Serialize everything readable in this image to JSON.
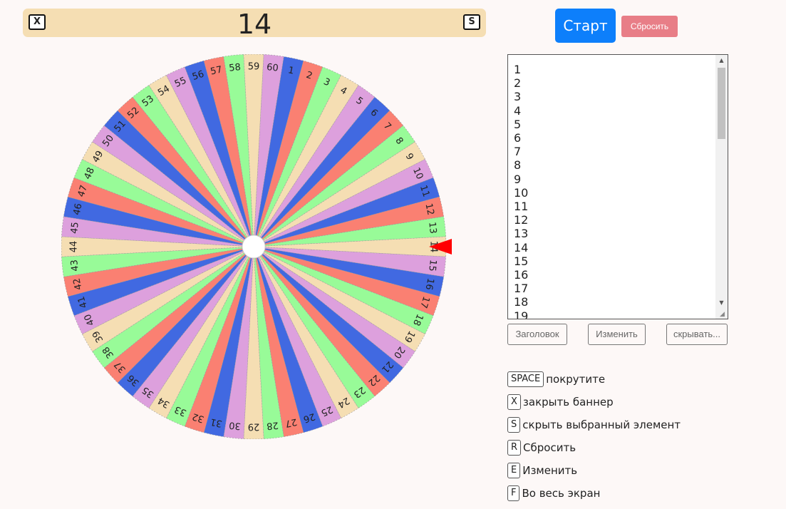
{
  "banner": {
    "title": "14",
    "close_key": "X",
    "hide_key": "S"
  },
  "controls": {
    "start_label": "Старт",
    "reset_label": "Сбросить",
    "start_color": "#0d7ffb",
    "reset_color": "#e87e87"
  },
  "wheel": {
    "items": [
      "1",
      "2",
      "3",
      "4",
      "5",
      "6",
      "7",
      "8",
      "9",
      "10",
      "11",
      "12",
      "13",
      "14",
      "15",
      "16",
      "17",
      "18",
      "19",
      "20",
      "21",
      "22",
      "23",
      "24",
      "25",
      "26",
      "27",
      "28",
      "29",
      "30",
      "31",
      "32",
      "33",
      "34",
      "35",
      "36",
      "37",
      "38",
      "39",
      "40",
      "41",
      "42",
      "43",
      "44",
      "45",
      "46",
      "47",
      "48",
      "49",
      "50",
      "51",
      "52",
      "53",
      "54",
      "55",
      "56",
      "57",
      "58",
      "59",
      "60"
    ],
    "colors": [
      "#4169e1",
      "#fa8072",
      "#98fb98",
      "#f5deb3",
      "#dda0dd"
    ],
    "pointer_color": "#ff0000",
    "pointer_icon": "pointer-arrow-icon",
    "selected": "14"
  },
  "list": {
    "text": "1\n2\n3\n4\n5\n6\n7\n8\n9\n10\n11\n12\n13\n14\n15\n16\n17\n18\n19"
  },
  "buttons": {
    "header_label": "Заголовок",
    "edit_label": "Изменить",
    "hide_label": "скрывать..."
  },
  "shortcuts": [
    {
      "key": "SPACE",
      "text": "покрутите"
    },
    {
      "key": "X",
      "text": "закрыть баннер"
    },
    {
      "key": "S",
      "text": "скрыть выбранный элемент"
    },
    {
      "key": "R",
      "text": "Сбросить"
    },
    {
      "key": "E",
      "text": "Изменить"
    },
    {
      "key": "F",
      "text": "Во весь экран"
    }
  ]
}
